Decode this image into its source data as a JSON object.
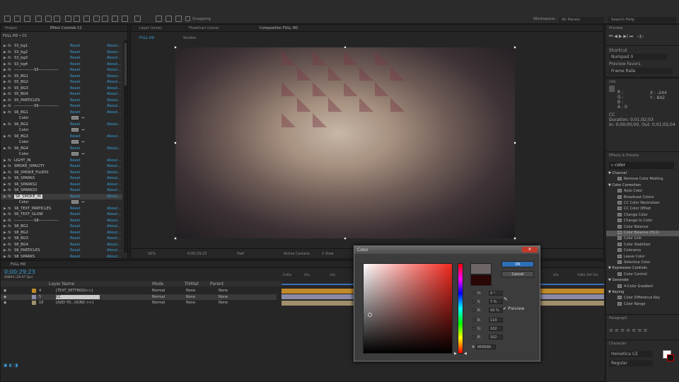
{
  "toolbar": {
    "snapping": "Snapping",
    "workspace_label": "Workspace:",
    "workspace_value": "All Panels",
    "search_help": "Search Help"
  },
  "project_panel": {
    "tab_project": "Project",
    "tab_effect_controls": "Effect Controls CC",
    "subtitle": "FULL HD • CC"
  },
  "effects": [
    {
      "name": "S3_bg1",
      "type": "fx"
    },
    {
      "name": "S3_bg2",
      "type": "fx"
    },
    {
      "name": "S3_bg3",
      "type": "fx"
    },
    {
      "name": "S3_bg4",
      "type": "fx"
    },
    {
      "name": "---------------S5---------------",
      "type": "fx"
    },
    {
      "name": "S5_BG1",
      "type": "fx"
    },
    {
      "name": "S5_BG2",
      "type": "fx"
    },
    {
      "name": "S5_BG3",
      "type": "fx"
    },
    {
      "name": "S5_BG4",
      "type": "fx"
    },
    {
      "name": "S5_PARTICLES",
      "type": "fx"
    },
    {
      "name": "---------------S6---------------",
      "type": "fx"
    },
    {
      "name": "S6_BG1",
      "type": "fx"
    },
    {
      "name": "Color",
      "type": "color"
    },
    {
      "name": "S6_BG2",
      "type": "fx"
    },
    {
      "name": "Color",
      "type": "color"
    },
    {
      "name": "S6_BG3",
      "type": "fx"
    },
    {
      "name": "Color",
      "type": "color"
    },
    {
      "name": "S6_BG4",
      "type": "fx"
    },
    {
      "name": "Color",
      "type": "color"
    },
    {
      "name": "LIGHT_IN",
      "type": "fx"
    },
    {
      "name": "SMOKE_OPACITY",
      "type": "fx"
    },
    {
      "name": "S6_SMOKE_FLUIDS",
      "type": "fx"
    },
    {
      "name": "S6_SPARKS",
      "type": "fx"
    },
    {
      "name": "S6_SPARKS2",
      "type": "fx"
    },
    {
      "name": "S6_SPARKS3",
      "type": "fx"
    },
    {
      "name": "S6_SMOKE_IN",
      "type": "fx",
      "selected": true
    },
    {
      "name": "Color",
      "type": "color"
    },
    {
      "name": "S6_TEXT_PARTICLES",
      "type": "fx"
    },
    {
      "name": "S6_TEXT_GLOW",
      "type": "fx"
    },
    {
      "name": "---------------S8---------------",
      "type": "fx"
    },
    {
      "name": "S8_BG1",
      "type": "fx"
    },
    {
      "name": "S8_BG2",
      "type": "fx"
    },
    {
      "name": "S8_BG3",
      "type": "fx"
    },
    {
      "name": "S8_BG4",
      "type": "fx"
    },
    {
      "name": "S8_PARTICLES",
      "type": "fx"
    },
    {
      "name": "S8_SPARKS",
      "type": "fx"
    }
  ],
  "effect_reset_label": "Reset",
  "effect_about_label": "About...",
  "comp": {
    "tab_layer": "Layer (none)",
    "tab_flowchart": "Flowchart (none)",
    "tab_composition": "Composition FULL HD",
    "subtab": "FULL HD",
    "subtab2": "Smokin",
    "zoom": "50%",
    "timecode": "0;00;29;23",
    "resolution": "Half",
    "camera": "Active Camera",
    "views": "1 View"
  },
  "preview_panel": {
    "title": "Preview",
    "shortcut_label": "Shortcut",
    "shortcut_value": "Numpad 0",
    "preview_favors": "Preview Favors",
    "favors_value": "Frame Rate"
  },
  "info_panel": {
    "title": "Info",
    "r": "R :",
    "g": "G :",
    "b": "B :",
    "a": "A : 0",
    "x": "X : -244",
    "y": "Y : 842",
    "comp_name": "CC",
    "duration": "Duration: 0;01;02;03",
    "inout": "In: 0;00;00;00, Out: 0;01;02;04"
  },
  "effects_presets": {
    "title": "Effects & Presets",
    "search": "color",
    "tree": [
      {
        "label": "Channel",
        "cat": true
      },
      {
        "label": "Remove Color Matting"
      },
      {
        "label": "Color Correction",
        "cat": true
      },
      {
        "label": "Auto Color"
      },
      {
        "label": "Broadcast Colors"
      },
      {
        "label": "CC Color Neutralizer"
      },
      {
        "label": "CC Color Offset"
      },
      {
        "label": "Change Color"
      },
      {
        "label": "Change to Color"
      },
      {
        "label": "Color Balance"
      },
      {
        "label": "Color Balance (HLS)",
        "selected": true
      },
      {
        "label": "Color Link"
      },
      {
        "label": "Color Stabilizer"
      },
      {
        "label": "Colorama"
      },
      {
        "label": "Leave Color"
      },
      {
        "label": "Selective Color"
      },
      {
        "label": "Expression Controls",
        "cat": true
      },
      {
        "label": "Color Control"
      },
      {
        "label": "Generate",
        "cat": true
      },
      {
        "label": "4-Color Gradient"
      },
      {
        "label": "Keying",
        "cat": true
      },
      {
        "label": "Color Difference Key"
      },
      {
        "label": "Color Range"
      }
    ]
  },
  "paragraph_panel": {
    "title": "Paragraph"
  },
  "character_panel": {
    "title": "Character",
    "font": "Helvetica CE",
    "style": "Regular"
  },
  "timeline": {
    "tab": "FULL HD",
    "timecode": "0;00;29;23",
    "fps": "00893 (29.97 fps)",
    "col_layer_name": "Layer Name",
    "col_mode": "Mode",
    "col_trkmat": "TrkMat",
    "col_parent": "Parent",
    "layers": [
      {
        "num": "4",
        "name": "[TEXT_SETTINGS>>]",
        "mode": "Normal",
        "trk": "None",
        "parent": "None",
        "color": "#c08a2a"
      },
      {
        "num": "5",
        "name": "CC",
        "mode": "Normal",
        "trk": "None",
        "parent": "None",
        "color": "#8a8aa8"
      },
      {
        "num": "19",
        "name": "[ADD YO...OUND >>]",
        "mode": "Normal",
        "trk": "None",
        "parent": "None",
        "color": "#a08f6a"
      }
    ],
    "ruler": [
      "0:00s",
      "05s",
      "10s",
      "15s",
      "45s",
      "50s",
      "55s",
      "01:00f"
    ]
  },
  "color_dialog": {
    "title": "Color",
    "ok": "OK",
    "cancel": "Cancel",
    "preview": "Preview",
    "h_label": "H:",
    "h_val": "0 °",
    "s_label": "S:",
    "s_val": "7 %",
    "b_label": "B:",
    "b_val": "43 %",
    "r_label": "R:",
    "r_val": "110",
    "g_label": "G:",
    "g_val": "102",
    "bb_label": "B:",
    "bb_val": "102",
    "hex_label": "#",
    "hex_val": "6E6666",
    "new_color": "#6e6666",
    "old_color": "#2a0606"
  }
}
